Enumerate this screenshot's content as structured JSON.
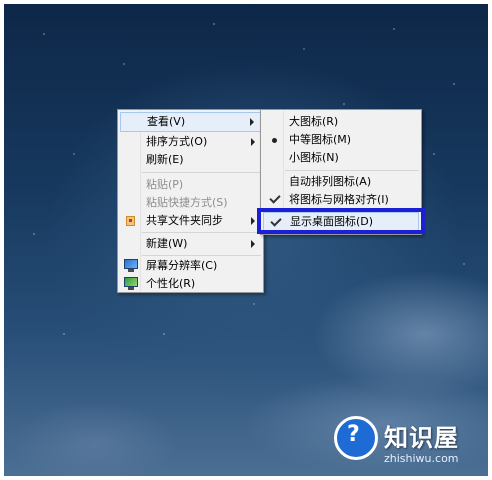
{
  "main_menu": {
    "items": [
      {
        "label": "查看(V)"
      },
      {
        "label": "排序方式(O)"
      },
      {
        "label": "刷新(E)"
      },
      {
        "label": "粘贴(P)"
      },
      {
        "label": "粘贴快捷方式(S)"
      },
      {
        "label": "共享文件夹同步"
      },
      {
        "label": "新建(W)"
      },
      {
        "label": "屏幕分辨率(C)"
      },
      {
        "label": "个性化(R)"
      }
    ]
  },
  "view_submenu": {
    "items": [
      {
        "label": "大图标(R)"
      },
      {
        "label": "中等图标(M)"
      },
      {
        "label": "小图标(N)"
      },
      {
        "label": "自动排列图标(A)"
      },
      {
        "label": "将图标与网格对齐(I)"
      },
      {
        "label": "显示桌面图标(D)"
      }
    ]
  },
  "watermark": {
    "title": "知识屋",
    "site": "zhishiwu.com"
  },
  "colors": {
    "highlight_border": "#1b1fd6",
    "menu_background": "#f1f1f1",
    "hover_background": "#e5eef9"
  },
  "icons": {
    "share": "share-sync-icon",
    "resolution": "monitor-icon",
    "personalize": "personalize-icon",
    "watermark": "question-badge-icon"
  }
}
